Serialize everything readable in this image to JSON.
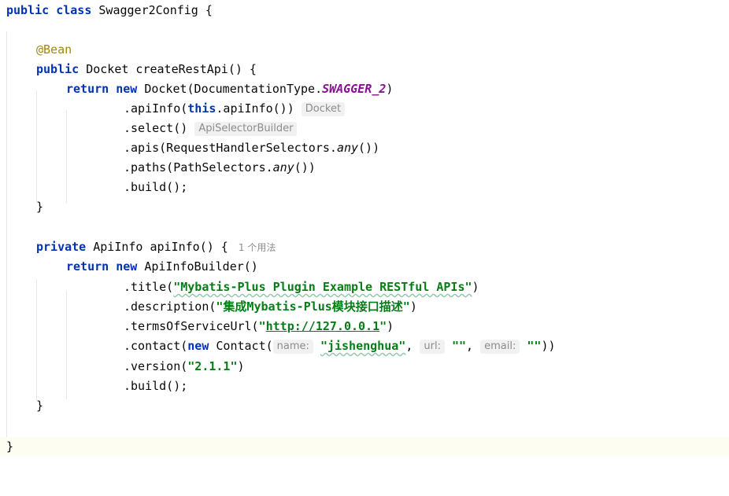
{
  "editor": {
    "class_decl": {
      "kw": "public class",
      "name": "Swagger2Config",
      "brace": "{"
    },
    "annotation": "@Bean",
    "method1": {
      "kw": "public",
      "sig": "Docket createRestApi() {",
      "return_kw": "return",
      "new_kw": "new",
      "ctor": "Docket(DocumentationType.",
      "field": "SWAGGER_2",
      "close": ")",
      "chain": {
        "apiinfo_pre": ".apiInfo(",
        "this_kw": "this",
        "apiinfo_post": ".apiInfo())",
        "apiinfo_hint": "Docket",
        "select": ".select()",
        "select_hint": "ApiSelectorBuilder",
        "apis_pre": ".apis(RequestHandlerSelectors.",
        "apis_any": "any",
        "apis_post": "())",
        "paths_pre": ".paths(PathSelectors.",
        "paths_any": "any",
        "paths_post": "())",
        "build": ".build();"
      },
      "end": "}"
    },
    "method2": {
      "kw": "private",
      "sig": "ApiInfo apiInfo() {",
      "usage": "1 个用法",
      "return_kw": "return",
      "new_kw": "new",
      "ctor": "ApiInfoBuilder()",
      "title_pre": ".title(",
      "title_str": "\"Mybatis-Plus Plugin Example RESTful APIs\"",
      "title_post": ")",
      "desc_pre": ".description(",
      "desc_str": "\"集成Mybatis-Plus模块接口描述\"",
      "desc_post": ")",
      "terms_pre": ".termsOfServiceUrl(",
      "terms_q1": "\"",
      "terms_url": "http://127.0.0.1",
      "terms_q2": "\"",
      "terms_post": ")",
      "contact_pre": ".contact(",
      "contact_new": "new",
      "contact_cls": " Contact(",
      "hint_name": "name:",
      "name_val": "\"jishenghua\"",
      "comma1": ", ",
      "hint_url": "url:",
      "url_val": "\"\"",
      "comma2": ", ",
      "hint_email": "email:",
      "email_val": "\"\"",
      "contact_post": "))",
      "version_pre": ".version(",
      "version_str": "\"2.1.1\"",
      "version_post": ")",
      "build": ".build();",
      "end": "}"
    },
    "class_end": "}"
  }
}
